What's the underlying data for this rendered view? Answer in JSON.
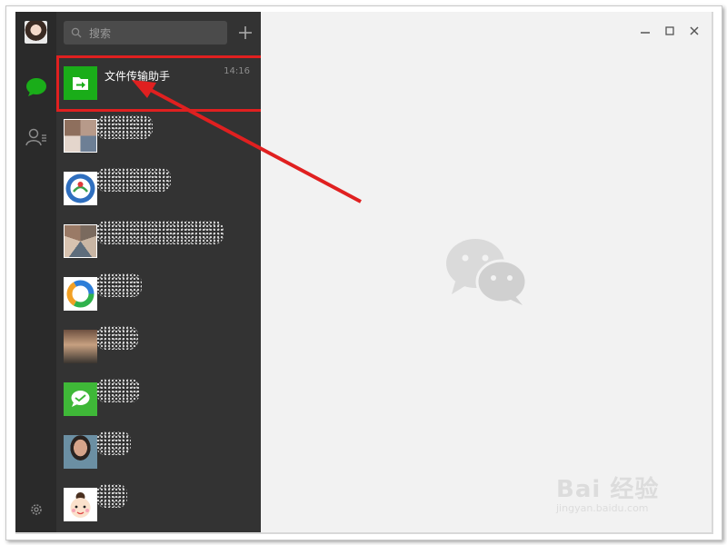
{
  "search": {
    "placeholder": "搜索"
  },
  "sessions": [
    {
      "name": "文件传输助手",
      "time": "14:16",
      "avatar": "folder-transfer-icon"
    },
    {
      "name": "",
      "time": "",
      "avatar": "group-photo-grid"
    },
    {
      "name": "",
      "time": "",
      "avatar": "round-logo"
    },
    {
      "name": "",
      "time": "",
      "avatar": "group-photo-grid"
    },
    {
      "name": "",
      "time": "",
      "avatar": "colorful-ring-logo"
    },
    {
      "name": "",
      "time": "",
      "avatar": "group-photo"
    },
    {
      "name": "",
      "time": "",
      "avatar": "green-chat-logo"
    },
    {
      "name": "",
      "time": "",
      "avatar": "portrait-photo"
    },
    {
      "name": "",
      "time": "",
      "avatar": "cartoon-face"
    }
  ],
  "window_controls": {
    "minimize": "minimize-icon",
    "maximize": "maximize-icon",
    "close": "close-icon"
  },
  "placeholder_logo": "wechat-logo",
  "watermark": {
    "text": "Bai  经验",
    "url": "jingyan.baidu.com"
  },
  "colors": {
    "accent": "#1aad19",
    "annotation": "#e02020",
    "sidebar": "#2a2a2a",
    "list": "#333333",
    "chat_bg": "#f2f2f2"
  }
}
